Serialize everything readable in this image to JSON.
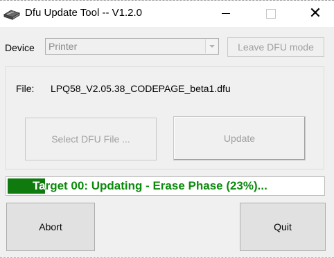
{
  "window": {
    "title": "Dfu Update Tool -- V1.2.0",
    "icon": "printer-icon",
    "controls": {
      "minimize": "minimize",
      "maximize": "maximize",
      "close": "✕"
    }
  },
  "device": {
    "label": "Device",
    "selected": "Printer",
    "leave_button": "Leave DFU mode"
  },
  "file": {
    "label": "File:",
    "name": "LPQ58_V2.05.38_CODEPAGE_beta1.dfu",
    "select_button": "Select DFU File ...",
    "update_button": "Update"
  },
  "progress": {
    "status": "Target 00: Updating - Erase Phase (23%)...",
    "fraction": 0.23,
    "fill_color": "#0f7b0f",
    "text_color": "#0b8a0b"
  },
  "actions": {
    "abort": "Abort",
    "quit": "Quit"
  }
}
